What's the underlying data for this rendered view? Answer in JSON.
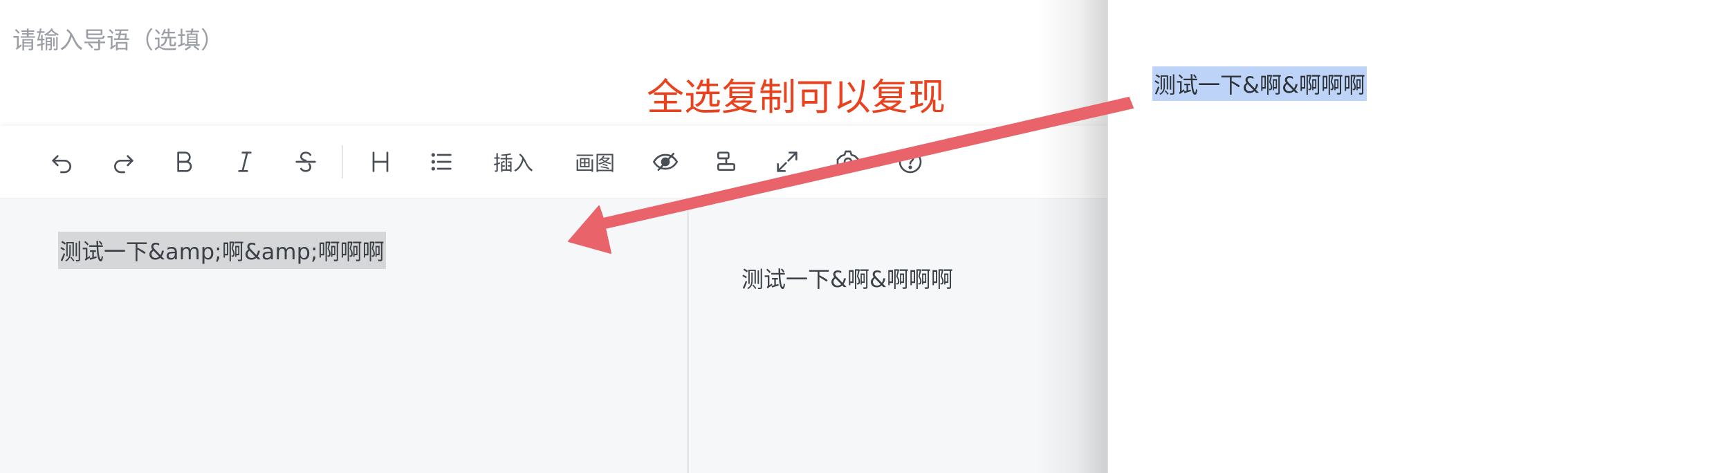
{
  "guide": {
    "placeholder": "请输入导语（选填）"
  },
  "toolbar": {
    "undo_icon": "undo-icon",
    "redo_icon": "redo-icon",
    "bold_icon": "bold-icon",
    "italic_icon": "italic-icon",
    "strikethrough_icon": "strikethrough-icon",
    "heading_icon": "heading-icon",
    "list_icon": "list-icon",
    "insert_label": "插入",
    "draw_label": "画图",
    "preview_icon": "eye-icon",
    "align_icon": "align-icon",
    "fullscreen_icon": "expand-icon",
    "settings_icon": "gear-icon",
    "help_icon": "help-icon"
  },
  "editor": {
    "text": "测试一下&amp;啊&amp;啊啊啊"
  },
  "preview": {
    "text": "测试一下&啊&啊啊啊"
  },
  "right_panel": {
    "text": "测试一下&啊&啊啊啊"
  },
  "annotation": {
    "text": "全选复制可以复现",
    "color": "#e8421f",
    "arrow_color": "#e8636a"
  }
}
